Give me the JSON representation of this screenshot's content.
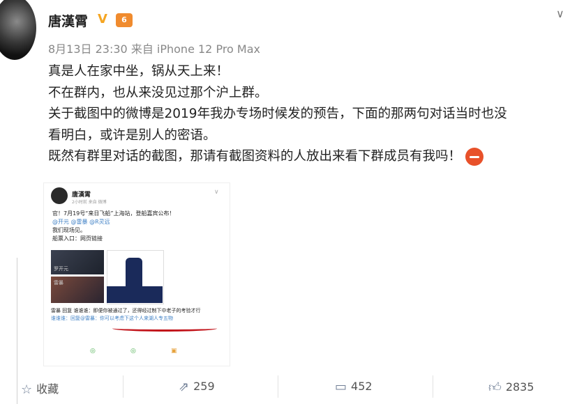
{
  "post": {
    "author": "唐漢霄",
    "vip_badge": "V",
    "level_badge": "6",
    "meta": "8月13日 23:30 来自 iPhone 12 Pro Max",
    "lines": [
      "真是人在家中坐，锅从天上来！",
      "不在群内，也从来没见过那个沪上群。",
      "关于截图中的微博是2019年我办专场时候发的预告，下面的那两句对话当时也没",
      "看明白，或许是别人的密语。",
      "既然有群里对话的截图，那请有截图资料的人放出来看下群成员有我吗！"
    ]
  },
  "screenshot": {
    "author": "唐漢霄",
    "time": "2小时前  来自 微博",
    "text_lines": [
      "官！7月19号“来日飞船”上海站，登船嘉宾公布！",
      "@开元 @雷暴 @R灵远",
      "我们现场见。",
      "船票入口：网页链接"
    ],
    "img_labels": [
      "罗开元",
      "雷暴"
    ],
    "comment_lines": [
      "雷暴 回复 谁谁谁：即便你被通过了，还得经过制下中老子的考验才行",
      "谁谁谁：回复@雷暴：你可以考虑下这个人来湖人专五物"
    ]
  },
  "actions": {
    "favorite": "收藏",
    "repost": "259",
    "comment": "452",
    "like": "2835"
  }
}
